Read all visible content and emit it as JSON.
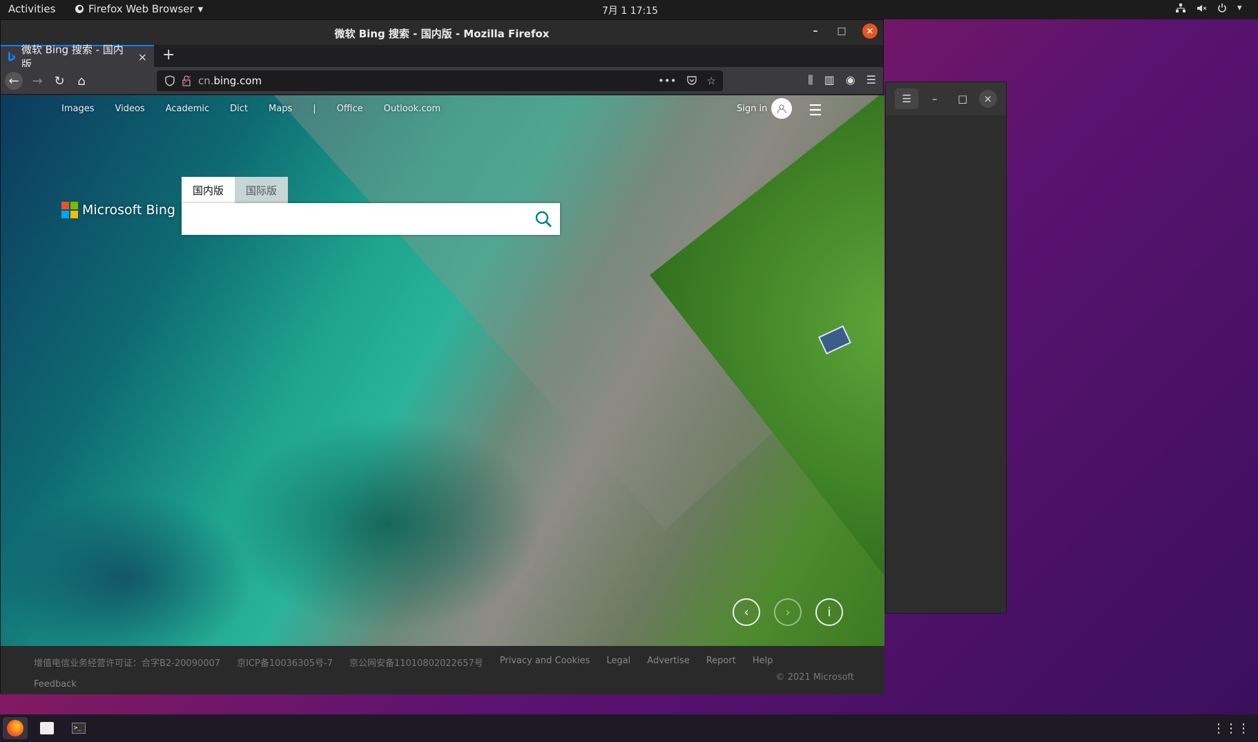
{
  "topbar": {
    "activities": "Activities",
    "app_name": "Firefox Web Browser",
    "clock": "7月 1  17:15"
  },
  "window": {
    "title": "微软 Bing 搜索 - 国内版 - Mozilla Firefox",
    "minimize": "–",
    "maximize": "□",
    "close": "×"
  },
  "tab": {
    "label": "微软 Bing 搜索 - 国内版",
    "close": "×",
    "new_tab": "+"
  },
  "url": {
    "prefix": "cn.",
    "host": "bing.com",
    "more": "•••"
  },
  "bing": {
    "nav": [
      "Images",
      "Videos",
      "Academic",
      "Dict",
      "Maps",
      "|",
      "Office",
      "Outlook.com"
    ],
    "sign_in": "Sign in",
    "logo_text": "Microsoft Bing",
    "tabs": [
      "国内版",
      "国际版"
    ],
    "search_value": "",
    "search_placeholder": ""
  },
  "footer": {
    "items": [
      "增值电信业务经营许可证：合字B2-20090007",
      "京ICP备10036305号-7",
      "京公网安备11010802022657号"
    ],
    "links": [
      "Privacy and Cookies",
      "Legal",
      "Advertise",
      "Report",
      "Help"
    ],
    "feedback": "Feedback",
    "copyright": "© 2021 Microsoft"
  },
  "colors": {
    "ubuntu_orange": "#e95420",
    "firefox_blue": "#0a84ff",
    "bing_teal": "#00809d"
  }
}
